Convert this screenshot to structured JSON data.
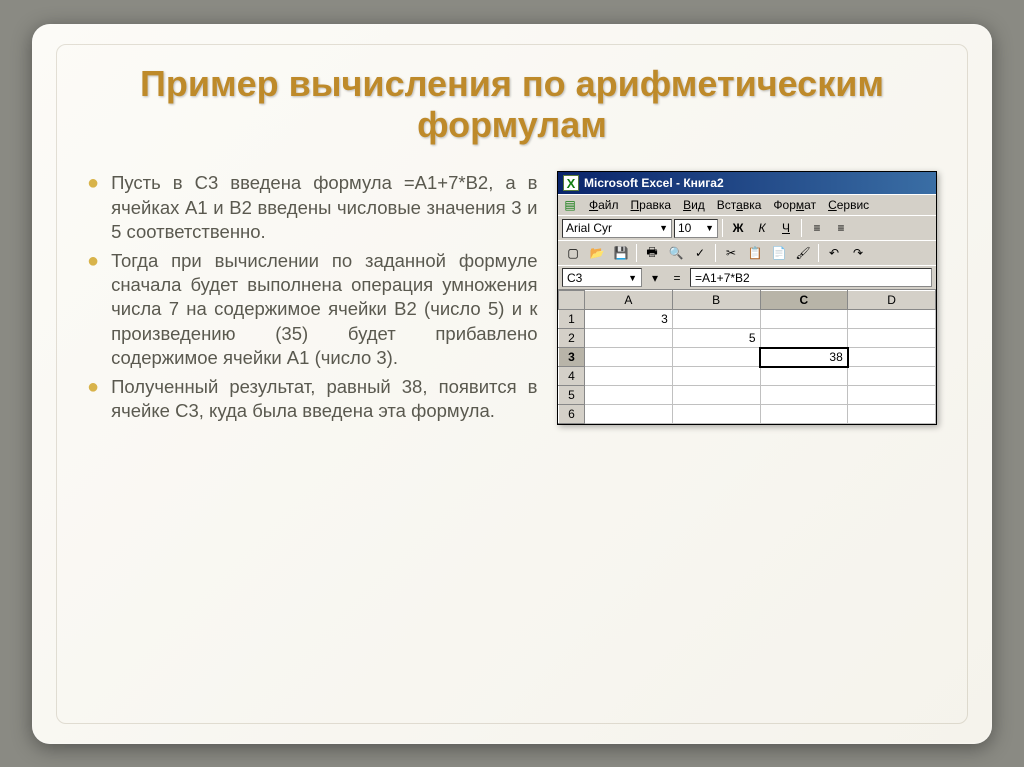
{
  "slide": {
    "title": "Пример вычисления по арифметическим формулам",
    "bullets": [
      "Пусть в C3 введена формула =A1+7*B2, а в ячейках A1 и B2 введены числовые значения 3 и 5 соответственно.",
      "Тогда при вычислении по заданной формуле сначала будет выполнена операция умножения числа 7 на содержимое ячейки B2 (число 5) и к произведению (35) будет прибавлено содержимое ячейки A1 (число 3).",
      "Полученный результат, равный 38, появится в ячейке C3, куда была введена эта формула."
    ]
  },
  "excel": {
    "title": "Microsoft Excel - Книга2",
    "menus": {
      "file": "Файл",
      "edit": "Правка",
      "view": "Вид",
      "insert": "Вставка",
      "format": "Формат",
      "service": "Сервис"
    },
    "font_name": "Arial Cyr",
    "font_size": "10",
    "fmt_buttons": {
      "bold": "Ж",
      "italic": "К",
      "underline": "Ч"
    },
    "namebox": "C3",
    "formula": "=A1+7*B2",
    "columns": [
      "A",
      "B",
      "C",
      "D"
    ],
    "rows": [
      "1",
      "2",
      "3",
      "4",
      "5",
      "6"
    ],
    "cells": {
      "A1": "3",
      "B2": "5",
      "C3": "38"
    }
  },
  "chart_data": {
    "type": "table",
    "title": "Excel spreadsheet snippet",
    "columns": [
      "A",
      "B",
      "C",
      "D"
    ],
    "rows": [
      {
        "row": "1",
        "A": 3,
        "B": null,
        "C": null,
        "D": null
      },
      {
        "row": "2",
        "A": null,
        "B": 5,
        "C": null,
        "D": null
      },
      {
        "row": "3",
        "A": null,
        "B": null,
        "C": 38,
        "D": null
      },
      {
        "row": "4",
        "A": null,
        "B": null,
        "C": null,
        "D": null
      },
      {
        "row": "5",
        "A": null,
        "B": null,
        "C": null,
        "D": null
      },
      {
        "row": "6",
        "A": null,
        "B": null,
        "C": null,
        "D": null
      }
    ],
    "active_cell": "C3",
    "formula": "=A1+7*B2"
  }
}
